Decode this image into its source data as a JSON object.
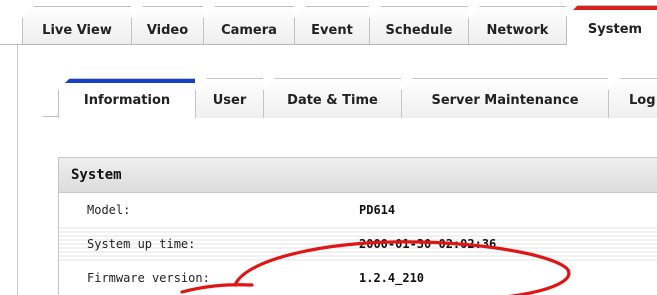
{
  "main_tabs": [
    {
      "label": "Live View"
    },
    {
      "label": "Video"
    },
    {
      "label": "Camera"
    },
    {
      "label": "Event"
    },
    {
      "label": "Schedule"
    },
    {
      "label": "Network"
    },
    {
      "label": "System"
    }
  ],
  "active_main_tab": "System",
  "sub_tabs": [
    {
      "label": "Information"
    },
    {
      "label": "User"
    },
    {
      "label": "Date & Time"
    },
    {
      "label": "Server Maintenance"
    },
    {
      "label": "Log"
    }
  ],
  "active_sub_tab": "Information",
  "section": {
    "title": "System",
    "rows": [
      {
        "key": "Model:",
        "value": "PD614"
      },
      {
        "key": "System up time:",
        "value": "2000-01-30 02:02:36"
      },
      {
        "key": "Firmware version:",
        "value": "1.2.4_210"
      }
    ]
  },
  "colors": {
    "active_main_tab_accent": "#d72020",
    "active_sub_tab_accent": "#1740c9",
    "highlight_ellipse": "#e01515"
  }
}
